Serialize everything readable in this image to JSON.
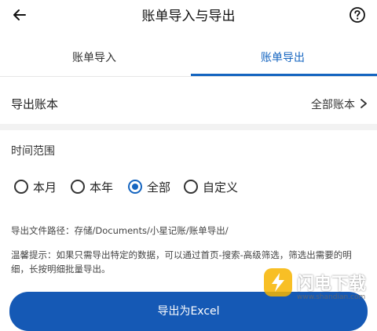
{
  "header": {
    "title": "账单导入与导出"
  },
  "tabs": [
    {
      "label": "账单导入",
      "selected": false
    },
    {
      "label": "账单导出",
      "selected": true
    }
  ],
  "account_row": {
    "label": "导出账本",
    "value": "全部账本"
  },
  "time_range": {
    "title": "时间范围",
    "options": [
      {
        "label": "本月",
        "checked": false
      },
      {
        "label": "本年",
        "checked": false
      },
      {
        "label": "全部",
        "checked": true
      },
      {
        "label": "自定义",
        "checked": false
      }
    ]
  },
  "path_text": "导出文件路径：存储/Documents/小星记账/账单导出/",
  "tip_text": "温馨提示：如果只需导出特定的数据，可以通过首页-搜索-高级筛选，筛选出需要的明细，长按明细批量导出。",
  "export_button": "导出为Excel",
  "watermark": {
    "text": "闪电下载",
    "sub": "www.shandian.com"
  },
  "colors": {
    "accent": "#1565c0",
    "button": "#1559b5",
    "text": "#222222"
  },
  "icons": [
    "back-arrow-icon",
    "help-icon",
    "chevron-right-icon"
  ]
}
